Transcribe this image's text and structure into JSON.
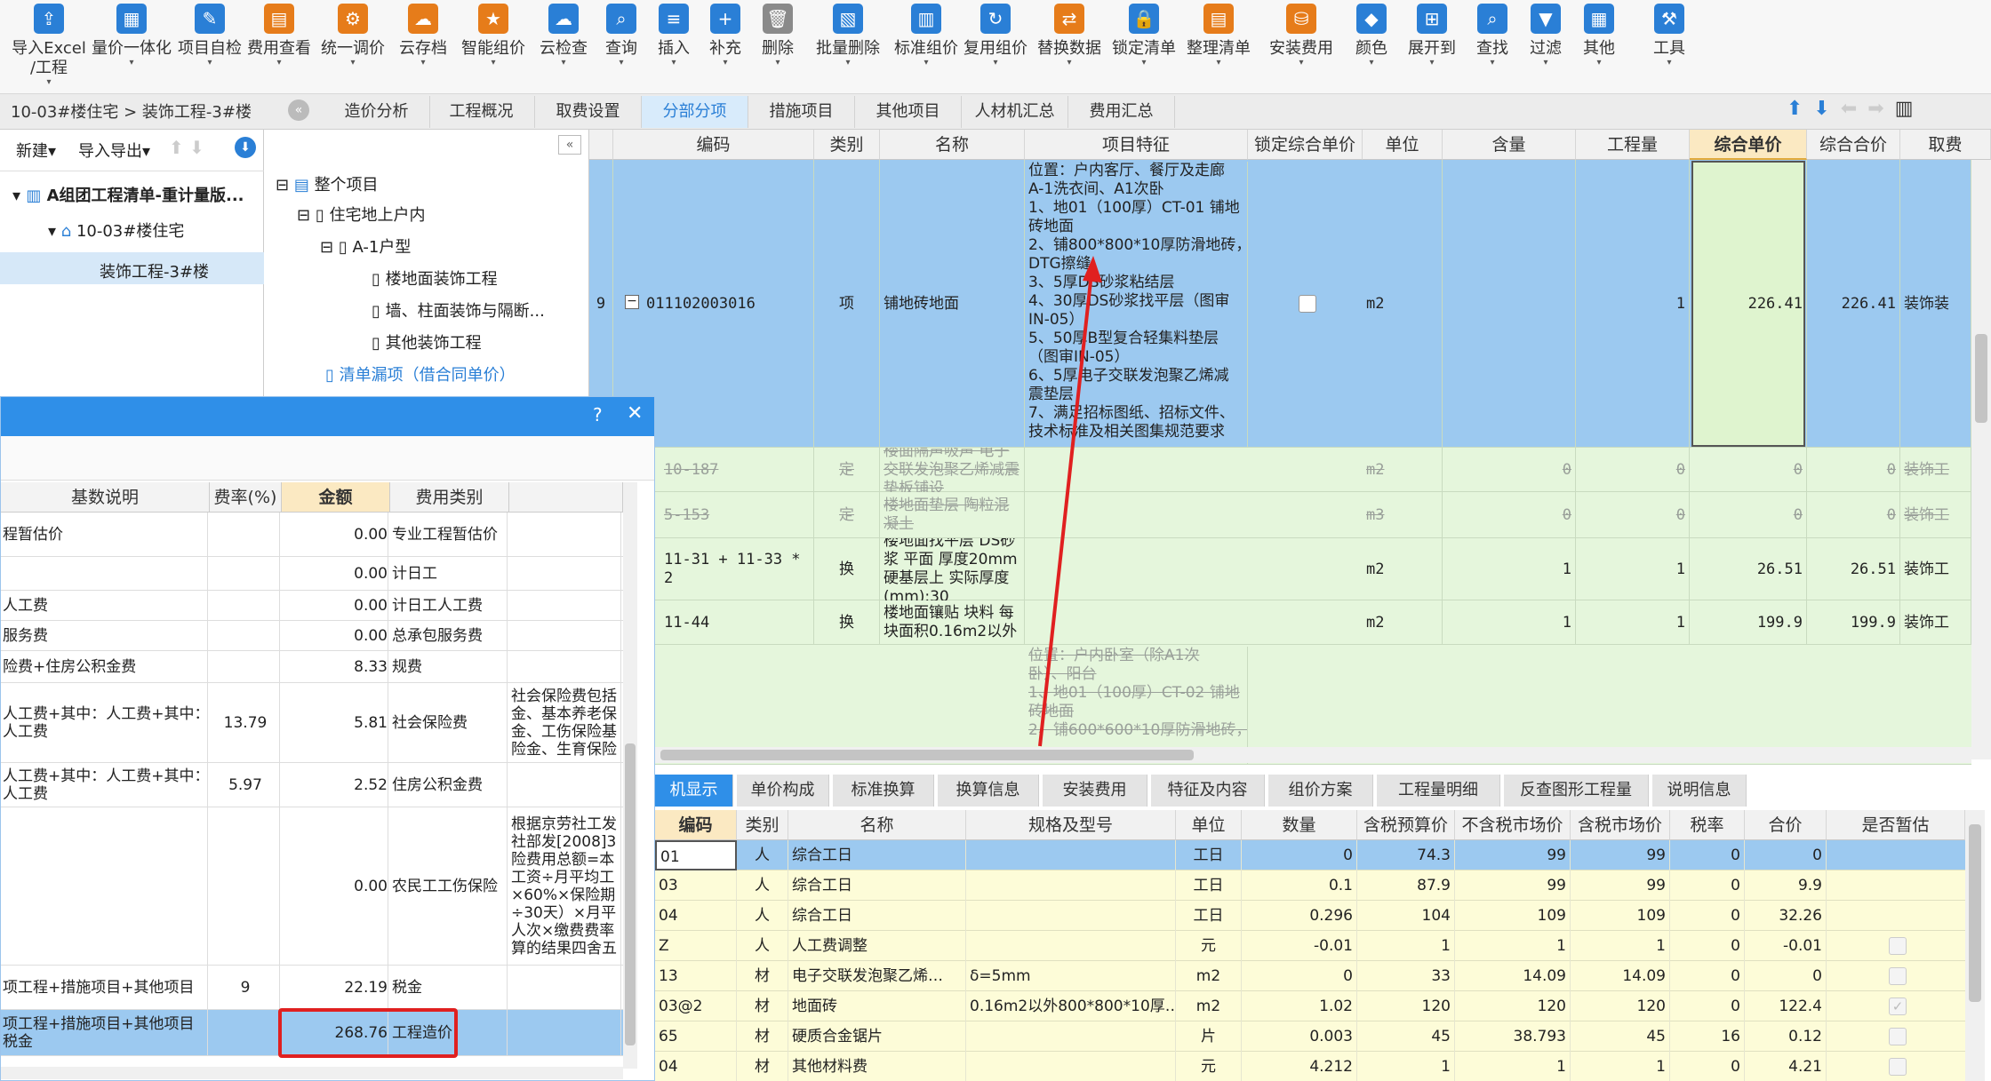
{
  "toolbar": {
    "items": [
      {
        "label": "导入Excel\n/工程",
        "icon": "import-excel-icon"
      },
      {
        "label": "量价一体化",
        "icon": "integration-icon"
      },
      {
        "label": "项目自检",
        "icon": "check-icon"
      },
      {
        "label": "费用查看",
        "icon": "fee-view-icon"
      },
      {
        "label": "统一调价",
        "icon": "adjust-price-icon"
      },
      {
        "label": "云存档",
        "icon": "cloud-upload-icon"
      },
      {
        "label": "智能组价",
        "icon": "smart-price-icon"
      },
      {
        "label": "云检查",
        "icon": "cloud-check-icon"
      },
      {
        "label": "查询",
        "icon": "query-icon"
      },
      {
        "label": "插入",
        "icon": "insert-icon"
      },
      {
        "label": "补充",
        "icon": "supplement-icon"
      },
      {
        "label": "删除",
        "icon": "trash-icon"
      },
      {
        "label": "批量删除",
        "icon": "batch-delete-icon"
      },
      {
        "label": "标准组价",
        "icon": "standard-price-icon"
      },
      {
        "label": "复用组价",
        "icon": "reuse-price-icon"
      },
      {
        "label": "替换数据",
        "icon": "replace-data-icon"
      },
      {
        "label": "锁定清单",
        "icon": "lock-icon"
      },
      {
        "label": "整理清单",
        "icon": "organize-list-icon"
      },
      {
        "label": "安装费用",
        "icon": "install-fee-icon"
      },
      {
        "label": "颜色",
        "icon": "color-icon"
      },
      {
        "label": "展开到",
        "icon": "expand-icon"
      },
      {
        "label": "查找",
        "icon": "find-icon"
      },
      {
        "label": "过滤",
        "icon": "filter-icon"
      },
      {
        "label": "其他",
        "icon": "other-grid-icon"
      },
      {
        "label": "工具",
        "icon": "tool-icon"
      }
    ]
  },
  "breadcrumb": "10-03#楼住宅 > 装饰工程-3#楼",
  "tabs": [
    "造价分析",
    "工程概况",
    "取费设置",
    "分部分项",
    "措施项目",
    "其他项目",
    "人材机汇总",
    "费用汇总"
  ],
  "active_tab": "分部分项",
  "left": {
    "new_label": "新建",
    "io_label": "导入导出",
    "tree": [
      "A组团工程清单-重计量版...",
      "10-03#楼住宅",
      "装饰工程-3#楼"
    ]
  },
  "project_tree": [
    "整个项目",
    "住宅地上户内",
    "A-1户型",
    "楼地面装饰工程",
    "墙、柱面装饰与隔断...",
    "其他装饰工程",
    "清单漏项（借合同单价）"
  ],
  "grid": {
    "headers": [
      "编码",
      "类别",
      "名称",
      "项目特征",
      "锁定综合单价",
      "单位",
      "含量",
      "工程量",
      "综合单价",
      "综合合价",
      "取费"
    ],
    "rows": [
      {
        "no": "9",
        "code": "011102003016",
        "type": "项",
        "name": "铺地砖地面",
        "feature": [
          "位置：户内客厅、餐厅及走廊",
          "A-1洗衣间、A1次卧",
          "1、地01（100厚）CT-01 铺地",
          "砖地面",
          "2、铺800*800*10厚防滑地砖，",
          "DTG擦缝",
          "3、5厚DS砂浆粘结层",
          "4、30厚DS砂浆找平层（图审",
          "IN-05）",
          "5、50厚B型复合轻集料垫层",
          "（图审IN-05）",
          "6、5厚电子交联发泡聚乙烯减",
          "震垫层",
          "7、满足招标图纸、招标文件、",
          "技术标准及相关图集规范要求"
        ],
        "unit": "m2",
        "qty_ratio": "",
        "quantity": "1",
        "unit_price": "226.41",
        "total": "226.41",
        "fee": "装饰装"
      },
      {
        "no": "",
        "code": "10-187",
        "type": "定",
        "name": "楼面隔声吸声 电子交联发泡聚乙烯减震垫板铺设",
        "unit": "m2",
        "qty_ratio": "0",
        "quantity": "0",
        "unit_price": "0",
        "total": "0",
        "fee": "装饰工"
      },
      {
        "no": "",
        "code": "5-153",
        "type": "定",
        "name": "楼地面垫层 陶粒混凝土",
        "unit": "m3",
        "qty_ratio": "0",
        "quantity": "0",
        "unit_price": "0",
        "total": "0",
        "fee": "装饰工"
      },
      {
        "no": "",
        "code": "11-31 + 11-33 * 2",
        "type": "换",
        "name": "楼地面找平层 DS砂浆 平面 厚度20mm 硬基层上 实际厚度(mm):30",
        "unit": "m2",
        "qty_ratio": "1",
        "quantity": "1",
        "unit_price": "26.51",
        "total": "26.51",
        "fee": "装饰工"
      },
      {
        "no": "",
        "code": "11-44",
        "type": "换",
        "name": "楼地面镶贴 块料 每块面积0.16m2以外",
        "unit": "m2",
        "qty_ratio": "1",
        "quantity": "1",
        "unit_price": "199.9",
        "total": "199.9",
        "fee": "装饰工"
      },
      {
        "no": "",
        "feature": [
          "位置：户内卧室（除A1次",
          "卧）、阳台",
          "1、地01（100厚）CT-02 铺地",
          "砖地面",
          "2、铺600*600*10厚防滑地砖，"
        ]
      }
    ]
  },
  "dialog": {
    "headers": [
      "基数说明",
      "费率(%)",
      "金额",
      "费用类别"
    ],
    "rows": [
      {
        "desc": "程暂估价",
        "rate": "",
        "amount": "0.00",
        "cat": "专业工程暂估价",
        "note": ""
      },
      {
        "desc": "",
        "rate": "",
        "amount": "0.00",
        "cat": "计日工",
        "note": ""
      },
      {
        "desc": "人工费",
        "rate": "",
        "amount": "0.00",
        "cat": "计日工人工费",
        "note": ""
      },
      {
        "desc": "服务费",
        "rate": "",
        "amount": "0.00",
        "cat": "总承包服务费",
        "note": ""
      },
      {
        "desc": "险费+住房公积金费",
        "rate": "",
        "amount": "8.33",
        "cat": "规费",
        "note": ""
      },
      {
        "desc": "人工费+其中：人工费+其中：\n人工费",
        "rate": "13.79",
        "amount": "5.81",
        "cat": "社会保险费",
        "note": "社会保险费包括\n金、基本养老保\n金、工伤保险基\n险金、生育保险"
      },
      {
        "desc": "人工费+其中：人工费+其中：\n人工费",
        "rate": "5.97",
        "amount": "2.52",
        "cat": "住房公积金费",
        "note": ""
      },
      {
        "desc": "",
        "rate": "",
        "amount": "0.00",
        "cat": "农民工工伤保险",
        "note": "根据京劳社工发\n社部发[2008]3\n险费用总额=本\n工资÷月平均工\n×60%×保险期\n÷30天）×月平\n人次×缴费费率\n算的结果四舍五"
      },
      {
        "desc": "项工程+措施项目+其他项目",
        "rate": "9",
        "amount": "22.19",
        "cat": "税金",
        "note": ""
      },
      {
        "desc": "项工程+措施项目+其他项目\n税金",
        "rate": "",
        "amount": "268.76",
        "cat": "工程造价",
        "note": ""
      }
    ]
  },
  "bottom": {
    "tabs": [
      "机显示",
      "单价构成",
      "标准换算",
      "换算信息",
      "安装费用",
      "特征及内容",
      "组价方案",
      "工程量明细",
      "反查图形工程量",
      "说明信息"
    ],
    "headers": [
      "编码",
      "类别",
      "名称",
      "规格及型号",
      "单位",
      "数量",
      "含税预算价",
      "不含税市场价",
      "含税市场价",
      "税率",
      "合价",
      "是否暂估"
    ],
    "rows": [
      {
        "code": "01",
        "type": "人",
        "name": "综合工日",
        "spec": "",
        "unit": "工日",
        "qty": "0",
        "budget": "74.3",
        "mkt_ex": "99",
        "mkt_in": "99",
        "tax": "0",
        "total": "0",
        "est": ""
      },
      {
        "code": "03",
        "type": "人",
        "name": "综合工日",
        "spec": "",
        "unit": "工日",
        "qty": "0.1",
        "budget": "87.9",
        "mkt_ex": "99",
        "mkt_in": "99",
        "tax": "0",
        "total": "9.9",
        "est": ""
      },
      {
        "code": "04",
        "type": "人",
        "name": "综合工日",
        "spec": "",
        "unit": "工日",
        "qty": "0.296",
        "budget": "104",
        "mkt_ex": "109",
        "mkt_in": "109",
        "tax": "0",
        "total": "32.26",
        "est": ""
      },
      {
        "code": "Z",
        "type": "人",
        "name": "人工费调整",
        "spec": "",
        "unit": "元",
        "qty": "-0.01",
        "budget": "1",
        "mkt_ex": "1",
        "mkt_in": "1",
        "tax": "0",
        "total": "-0.01",
        "est": "box"
      },
      {
        "code": "13",
        "type": "材",
        "name": "电子交联发泡聚乙烯…",
        "spec": "δ=5mm",
        "unit": "m2",
        "qty": "0",
        "budget": "33",
        "mkt_ex": "14.09",
        "mkt_in": "14.09",
        "tax": "0",
        "total": "0",
        "est": "box"
      },
      {
        "code": "03@2",
        "type": "材",
        "name": "地面砖",
        "spec": "0.16m2以外800*800*10厚…",
        "unit": "m2",
        "qty": "1.02",
        "budget": "120",
        "mkt_ex": "120",
        "mkt_in": "120",
        "tax": "0",
        "total": "122.4",
        "est": "checked"
      },
      {
        "code": "65",
        "type": "材",
        "name": "硬质合金锯片",
        "spec": "",
        "unit": "片",
        "qty": "0.003",
        "budget": "45",
        "mkt_ex": "38.793",
        "mkt_in": "45",
        "tax": "16",
        "total": "0.12",
        "est": "box"
      },
      {
        "code": "04",
        "type": "材",
        "name": "其他材料费",
        "spec": "",
        "unit": "元",
        "qty": "4.212",
        "budget": "1",
        "mkt_ex": "1",
        "mkt_in": "1",
        "tax": "0",
        "total": "4.21",
        "est": "box"
      }
    ]
  },
  "colors": {
    "accent": "#2f8fe8",
    "selected_row": "#9cc9f0",
    "green_row": "#e5f6dc",
    "highlight_box": "#e02020",
    "arrow": "#e02020"
  }
}
